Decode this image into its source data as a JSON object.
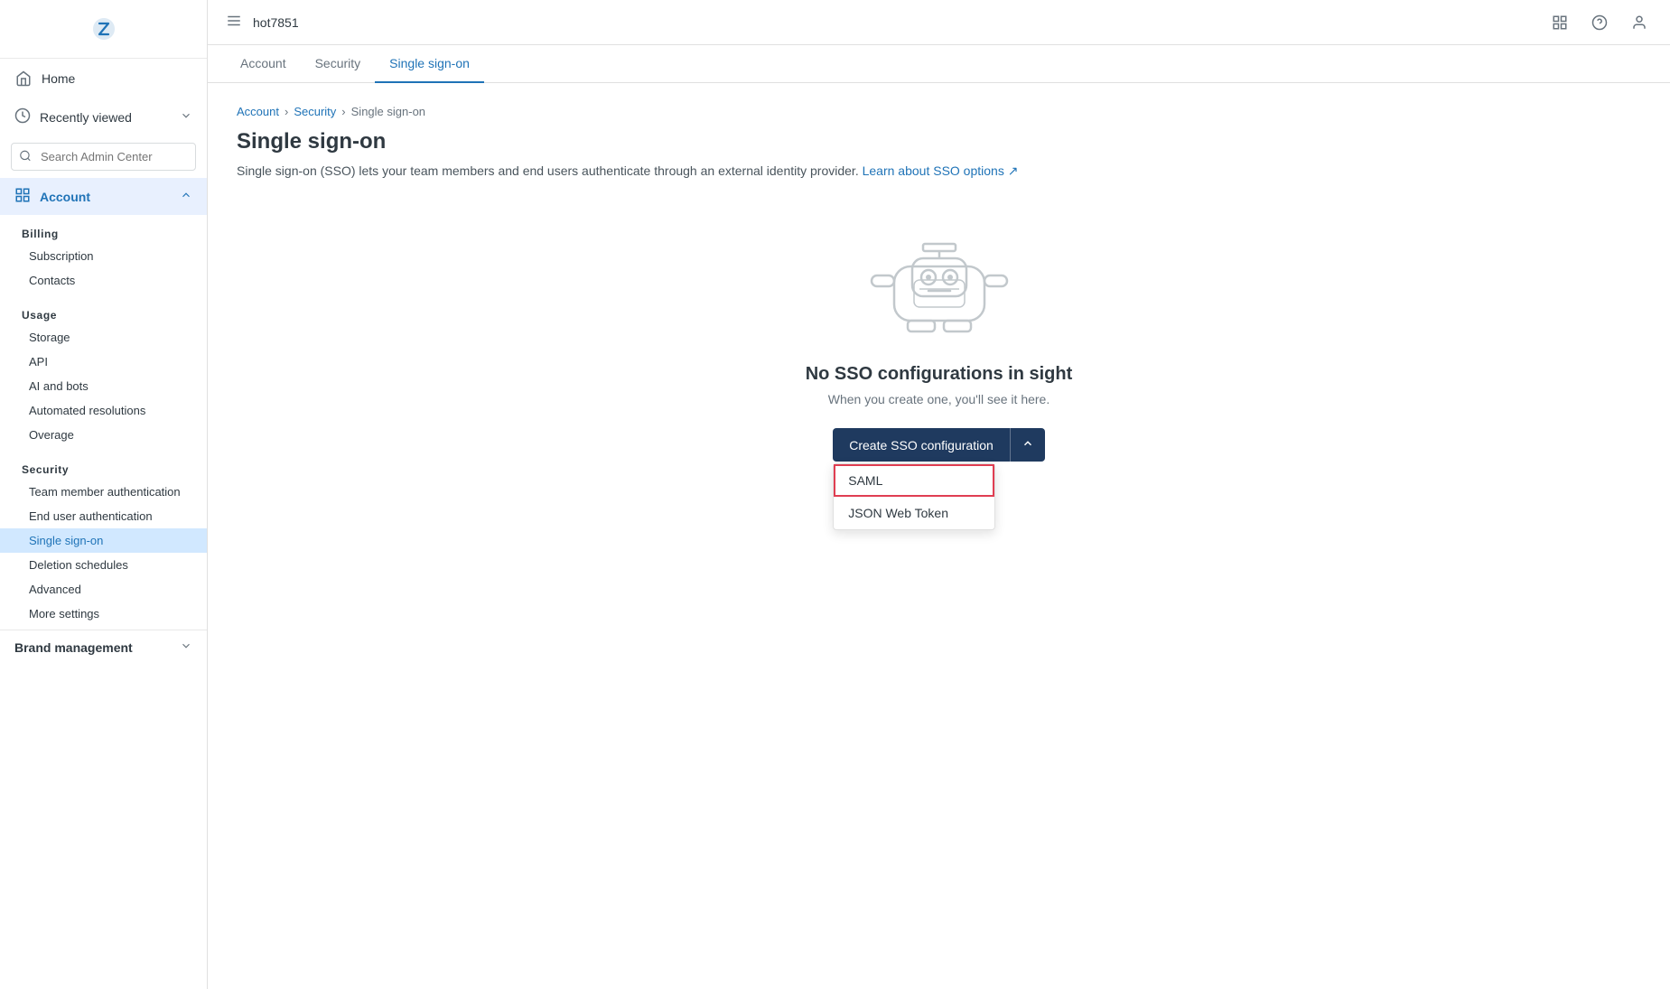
{
  "topbar": {
    "title": "hot7851",
    "icons": [
      "grid-icon",
      "help-icon",
      "user-icon"
    ]
  },
  "tabs": [
    {
      "label": "Account",
      "active": false
    },
    {
      "label": "Security",
      "active": false
    },
    {
      "label": "Single sign-on",
      "active": true
    }
  ],
  "sidebar": {
    "logo_alt": "Zendesk logo",
    "home_label": "Home",
    "recently_viewed_label": "Recently viewed",
    "search_placeholder": "Search Admin Center",
    "main_section": "Account",
    "sub_sections": [
      {
        "title": "Billing",
        "items": [
          "Subscription",
          "Contacts"
        ]
      },
      {
        "title": "Usage",
        "items": [
          "Storage",
          "API",
          "AI and bots",
          "Automated resolutions",
          "Overage"
        ]
      },
      {
        "title": "Security",
        "items": [
          "Team member authentication",
          "End user authentication",
          "Single sign-on",
          "Deletion schedules",
          "Advanced",
          "More settings"
        ]
      }
    ],
    "bottom_section": "Brand management",
    "active_item": "Single sign-on"
  },
  "breadcrumb": {
    "items": [
      "Account",
      "Security",
      "Single sign-on"
    ]
  },
  "page": {
    "title": "Single sign-on",
    "description": "Single sign-on (SSO) lets your team members and end users authenticate through an external identity provider.",
    "learn_more_text": "Learn about SSO options",
    "empty_state_title": "No SSO configurations in sight",
    "empty_state_desc": "When you create one, you'll see it here.",
    "create_button_label": "Create SSO configuration",
    "dropdown_items": [
      "SAML",
      "JSON Web Token"
    ]
  }
}
